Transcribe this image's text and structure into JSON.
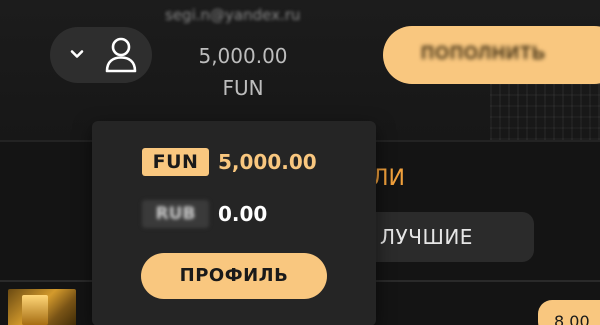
{
  "header": {
    "email": "segi.n@yandex.ru",
    "balance": {
      "amount": "5,000.00",
      "currency": "FUN"
    },
    "topup_label": "ПОПОЛНИТЬ"
  },
  "background": {
    "section_title": "ЛИ",
    "filter_chip_label": "ЛУЧШИЕ",
    "bet_value": "8.00"
  },
  "popup": {
    "wallets": [
      {
        "currency": "FUN",
        "amount": "5,000.00"
      },
      {
        "currency": "RUB",
        "amount": "0.00"
      }
    ],
    "profile_label": "ПРОФИЛЬ"
  },
  "icons": {
    "chevron": "chevron-down-icon",
    "user": "user-icon"
  },
  "colors": {
    "accent": "#f9c77f",
    "accent_text": "#f2a13c",
    "background": "#141414",
    "popup": "#252525"
  }
}
